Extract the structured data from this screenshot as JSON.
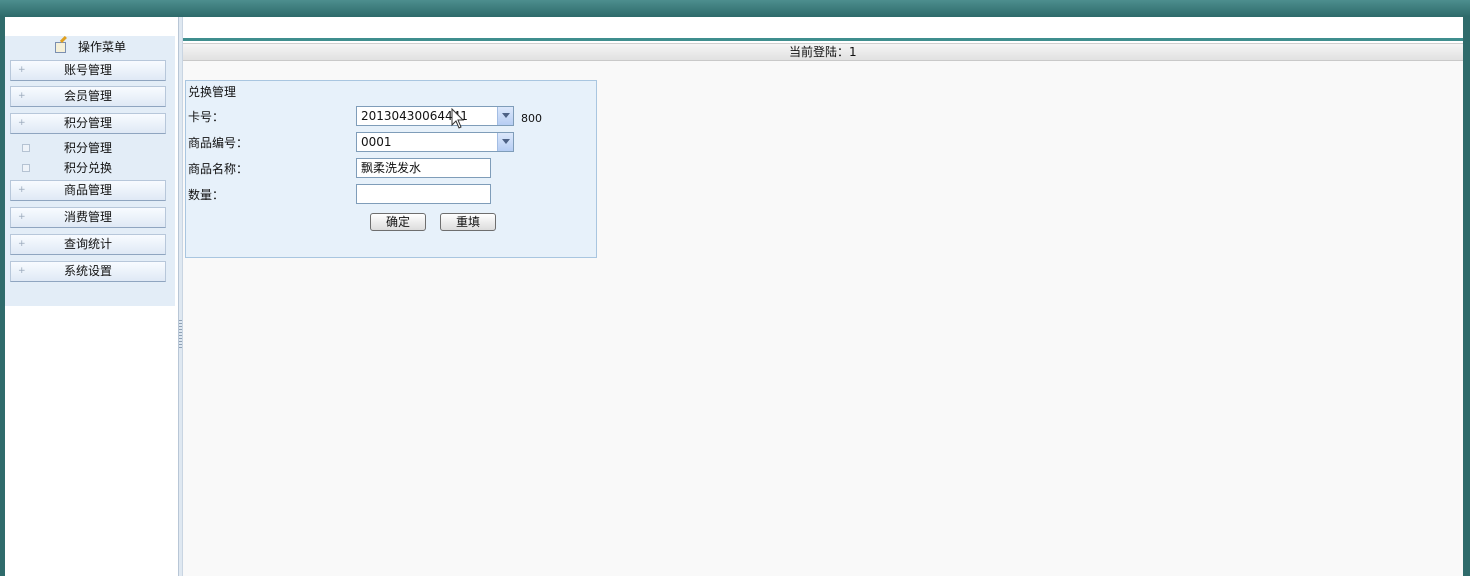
{
  "header": {
    "login_text": "当前登陆：1"
  },
  "sidebar": {
    "title": "操作菜单",
    "items": [
      {
        "label": "账号管理"
      },
      {
        "label": "会员管理"
      },
      {
        "label": "积分管理"
      },
      {
        "label": "积分管理",
        "sub": true
      },
      {
        "label": "积分兑换",
        "sub": true
      },
      {
        "label": "商品管理"
      },
      {
        "label": "消费管理"
      },
      {
        "label": "查询统计"
      },
      {
        "label": "系统设置"
      }
    ],
    "plus_glyph": "+"
  },
  "form": {
    "title": "兑换管理",
    "card_label": "卡号：",
    "card_value": "20130430064441",
    "card_points": "800",
    "product_code_label": "商品编号：",
    "product_code_value": "0001",
    "product_name_label": "商品名称：",
    "product_name_value": "飘柔洗发水",
    "quantity_label": "数量：",
    "quantity_value": "",
    "confirm_label": "确定",
    "reset_label": "重填"
  },
  "colors": {
    "frame": "#2f6b6b",
    "accent_line": "#3f8e8e",
    "panel": "#e7f1fa",
    "sidebar_panel": "#e3edf7"
  },
  "icons": {
    "menu_title_icon": "pencil-note-icon",
    "dropdown_icon": "chevron-down-icon"
  }
}
